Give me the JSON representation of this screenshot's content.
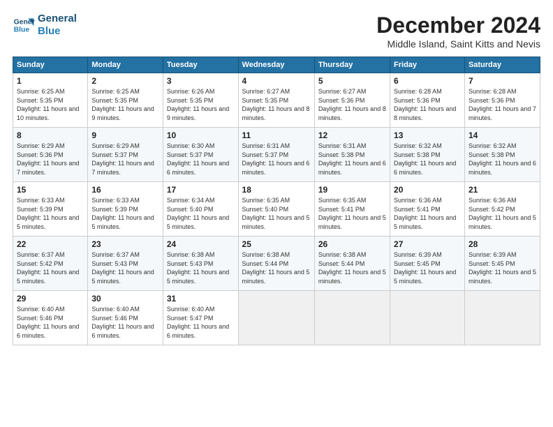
{
  "header": {
    "logo_line1": "General",
    "logo_line2": "Blue",
    "month": "December 2024",
    "location": "Middle Island, Saint Kitts and Nevis"
  },
  "weekdays": [
    "Sunday",
    "Monday",
    "Tuesday",
    "Wednesday",
    "Thursday",
    "Friday",
    "Saturday"
  ],
  "weeks": [
    [
      {
        "day": "1",
        "sunrise": "6:25 AM",
        "sunset": "5:35 PM",
        "daylight": "11 hours and 10 minutes."
      },
      {
        "day": "2",
        "sunrise": "6:25 AM",
        "sunset": "5:35 PM",
        "daylight": "11 hours and 9 minutes."
      },
      {
        "day": "3",
        "sunrise": "6:26 AM",
        "sunset": "5:35 PM",
        "daylight": "11 hours and 9 minutes."
      },
      {
        "day": "4",
        "sunrise": "6:27 AM",
        "sunset": "5:35 PM",
        "daylight": "11 hours and 8 minutes."
      },
      {
        "day": "5",
        "sunrise": "6:27 AM",
        "sunset": "5:36 PM",
        "daylight": "11 hours and 8 minutes."
      },
      {
        "day": "6",
        "sunrise": "6:28 AM",
        "sunset": "5:36 PM",
        "daylight": "11 hours and 8 minutes."
      },
      {
        "day": "7",
        "sunrise": "6:28 AM",
        "sunset": "5:36 PM",
        "daylight": "11 hours and 7 minutes."
      }
    ],
    [
      {
        "day": "8",
        "sunrise": "6:29 AM",
        "sunset": "5:36 PM",
        "daylight": "11 hours and 7 minutes."
      },
      {
        "day": "9",
        "sunrise": "6:29 AM",
        "sunset": "5:37 PM",
        "daylight": "11 hours and 7 minutes."
      },
      {
        "day": "10",
        "sunrise": "6:30 AM",
        "sunset": "5:37 PM",
        "daylight": "11 hours and 6 minutes."
      },
      {
        "day": "11",
        "sunrise": "6:31 AM",
        "sunset": "5:37 PM",
        "daylight": "11 hours and 6 minutes."
      },
      {
        "day": "12",
        "sunrise": "6:31 AM",
        "sunset": "5:38 PM",
        "daylight": "11 hours and 6 minutes."
      },
      {
        "day": "13",
        "sunrise": "6:32 AM",
        "sunset": "5:38 PM",
        "daylight": "11 hours and 6 minutes."
      },
      {
        "day": "14",
        "sunrise": "6:32 AM",
        "sunset": "5:38 PM",
        "daylight": "11 hours and 6 minutes."
      }
    ],
    [
      {
        "day": "15",
        "sunrise": "6:33 AM",
        "sunset": "5:39 PM",
        "daylight": "11 hours and 5 minutes."
      },
      {
        "day": "16",
        "sunrise": "6:33 AM",
        "sunset": "5:39 PM",
        "daylight": "11 hours and 5 minutes."
      },
      {
        "day": "17",
        "sunrise": "6:34 AM",
        "sunset": "5:40 PM",
        "daylight": "11 hours and 5 minutes."
      },
      {
        "day": "18",
        "sunrise": "6:35 AM",
        "sunset": "5:40 PM",
        "daylight": "11 hours and 5 minutes."
      },
      {
        "day": "19",
        "sunrise": "6:35 AM",
        "sunset": "5:41 PM",
        "daylight": "11 hours and 5 minutes."
      },
      {
        "day": "20",
        "sunrise": "6:36 AM",
        "sunset": "5:41 PM",
        "daylight": "11 hours and 5 minutes."
      },
      {
        "day": "21",
        "sunrise": "6:36 AM",
        "sunset": "5:42 PM",
        "daylight": "11 hours and 5 minutes."
      }
    ],
    [
      {
        "day": "22",
        "sunrise": "6:37 AM",
        "sunset": "5:42 PM",
        "daylight": "11 hours and 5 minutes."
      },
      {
        "day": "23",
        "sunrise": "6:37 AM",
        "sunset": "5:43 PM",
        "daylight": "11 hours and 5 minutes."
      },
      {
        "day": "24",
        "sunrise": "6:38 AM",
        "sunset": "5:43 PM",
        "daylight": "11 hours and 5 minutes."
      },
      {
        "day": "25",
        "sunrise": "6:38 AM",
        "sunset": "5:44 PM",
        "daylight": "11 hours and 5 minutes."
      },
      {
        "day": "26",
        "sunrise": "6:38 AM",
        "sunset": "5:44 PM",
        "daylight": "11 hours and 5 minutes."
      },
      {
        "day": "27",
        "sunrise": "6:39 AM",
        "sunset": "5:45 PM",
        "daylight": "11 hours and 5 minutes."
      },
      {
        "day": "28",
        "sunrise": "6:39 AM",
        "sunset": "5:45 PM",
        "daylight": "11 hours and 5 minutes."
      }
    ],
    [
      {
        "day": "29",
        "sunrise": "6:40 AM",
        "sunset": "5:46 PM",
        "daylight": "11 hours and 6 minutes."
      },
      {
        "day": "30",
        "sunrise": "6:40 AM",
        "sunset": "5:46 PM",
        "daylight": "11 hours and 6 minutes."
      },
      {
        "day": "31",
        "sunrise": "6:40 AM",
        "sunset": "5:47 PM",
        "daylight": "11 hours and 6 minutes."
      },
      null,
      null,
      null,
      null
    ]
  ],
  "labels": {
    "sunrise": "Sunrise:",
    "sunset": "Sunset:",
    "daylight": "Daylight:"
  }
}
